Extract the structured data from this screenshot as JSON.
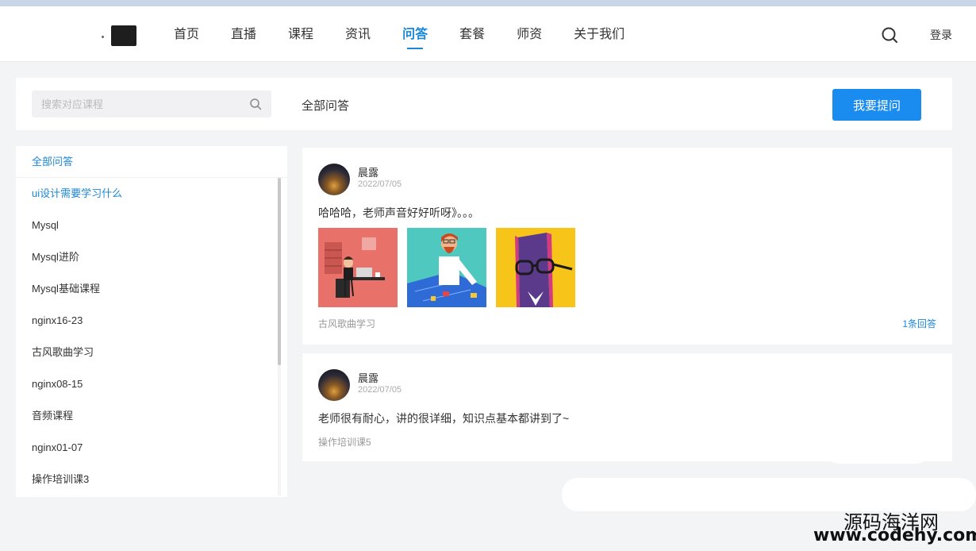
{
  "nav": {
    "items": [
      {
        "label": "首页"
      },
      {
        "label": "直播"
      },
      {
        "label": "课程"
      },
      {
        "label": "资讯"
      },
      {
        "label": "问答",
        "active": true
      },
      {
        "label": "套餐"
      },
      {
        "label": "师资"
      },
      {
        "label": "关于我们"
      }
    ],
    "login_label": "登录",
    "search_icon": "search-icon"
  },
  "toolbar": {
    "search_placeholder": "搜索对应课程",
    "title": "全部问答",
    "ask_label": "我要提问"
  },
  "sidebar": {
    "items": [
      {
        "label": "全部问答"
      },
      {
        "label": "ui设计需要学习什么"
      },
      {
        "label": "Mysql"
      },
      {
        "label": "Mysql进阶"
      },
      {
        "label": "Mysql基础课程"
      },
      {
        "label": "nginx16-23"
      },
      {
        "label": "古风歌曲学习"
      },
      {
        "label": "nginx08-15"
      },
      {
        "label": "音频课程"
      },
      {
        "label": "nginx01-07"
      },
      {
        "label": "操作培训课3"
      }
    ]
  },
  "posts": [
    {
      "user": "晨露",
      "date": "2022/07/05",
      "content": "哈哈哈，老师声音好好听呀》。。。",
      "course": "古风歌曲学习",
      "answers": "1条回答"
    },
    {
      "user": "晨露",
      "date": "2022/07/05",
      "content": "老师很有耐心，讲的很详细，知识点基本都讲到了~",
      "course": "操作培训课5"
    }
  ],
  "watermark": {
    "name": "源码海洋网",
    "url": "www.codehy.com"
  },
  "colors": {
    "accent": "#1a87d9",
    "button": "#1a8cf0",
    "page_bg": "#f3f4f6"
  }
}
